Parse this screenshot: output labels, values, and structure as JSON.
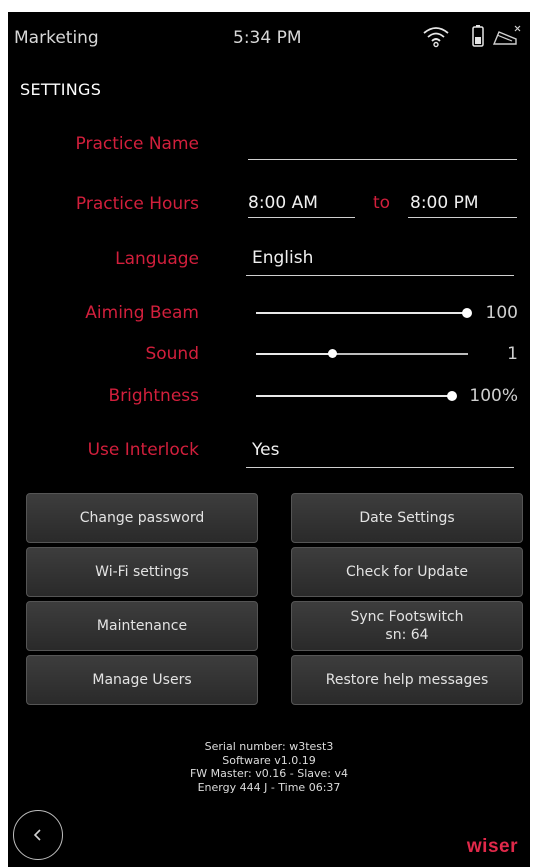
{
  "status_bar": {
    "app_name": "Marketing",
    "time": "5:34 PM",
    "icons": [
      "wifi-icon",
      "battery-icon",
      "footswitch-disconnected-icon"
    ]
  },
  "page": {
    "title": "SETTINGS"
  },
  "settings": {
    "practice_name": {
      "label": "Practice Name",
      "value": ""
    },
    "practice_hours": {
      "label": "Practice Hours",
      "from": "8:00 AM",
      "to_label": "to",
      "to": "8:00 PM"
    },
    "language": {
      "label": "Language",
      "value": "English"
    },
    "aiming_beam": {
      "label": "Aiming Beam",
      "value": 100,
      "display": "100"
    },
    "sound": {
      "label": "Sound",
      "value": 1,
      "max": 5,
      "display": "1"
    },
    "brightness": {
      "label": "Brightness",
      "value": 100,
      "display": "100%"
    },
    "use_interlock": {
      "label": "Use Interlock",
      "value": "Yes"
    }
  },
  "buttons": {
    "change_password": "Change password",
    "date_settings": "Date Settings",
    "wifi_settings": "Wi-Fi settings",
    "check_update": "Check for Update",
    "maintenance": "Maintenance",
    "sync_footswitch": "Sync Footswitch",
    "sync_footswitch_sn": "sn: 64",
    "manage_users": "Manage Users",
    "restore_help": "Restore help messages"
  },
  "footer": {
    "serial": "Serial number: w3test3",
    "software": "Software v1.0.19",
    "firmware": "FW Master: v0.16 - Slave: v4",
    "energy": "Energy 444 J - Time 06:37"
  },
  "logo_text": "wiser",
  "colors": {
    "accent": "#d21f3c",
    "background": "#000000",
    "logo": "#e0294a"
  }
}
